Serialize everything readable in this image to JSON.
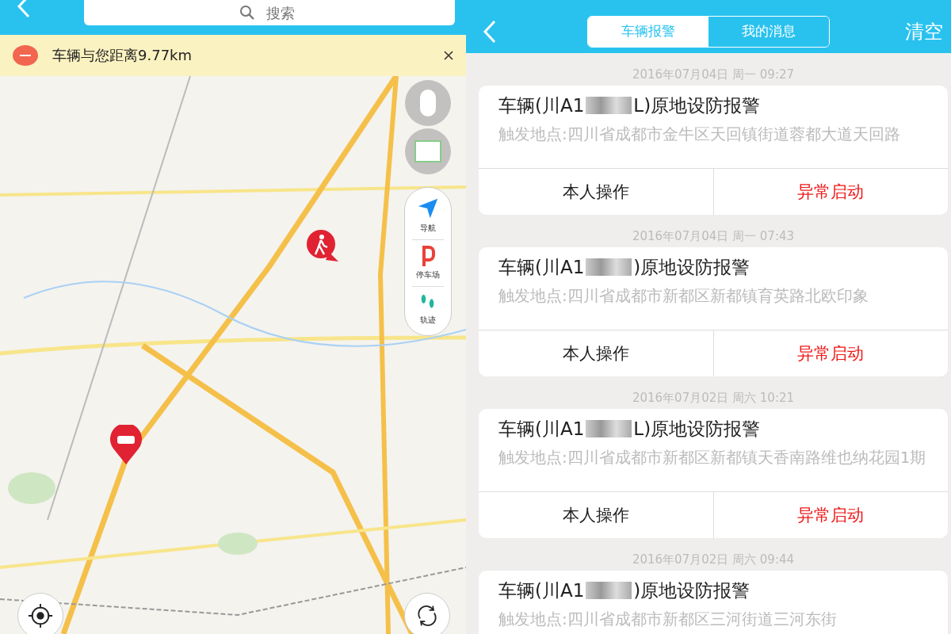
{
  "map_screen": {
    "search": {
      "placeholder": "搜索"
    },
    "banner": {
      "text": "车辆与您距离9.77km"
    },
    "side_tools": [
      {
        "kind": "navigate",
        "label": "导航"
      },
      {
        "kind": "parking",
        "label": "停车场"
      },
      {
        "kind": "track",
        "label": "轨迹"
      }
    ]
  },
  "alerts_screen": {
    "tabs": [
      {
        "label": "车辆报警",
        "selected": true
      },
      {
        "label": "我的消息",
        "selected": false
      }
    ],
    "clear_button": "清空",
    "alerts": [
      {
        "time": "2016年07月04日 周一 09:27",
        "title_start": "车辆(川A1",
        "title_end": "L)原地设防报警",
        "address": "触发地点:四川省成都市金牛区天回镇街道蓉都大道天回路",
        "actions": [
          "本人操作",
          "异常启动"
        ]
      },
      {
        "time": "2016年07月04日 周一 07:43",
        "title_start": "车辆(川A1",
        "title_end": ")原地设防报警",
        "address": "触发地点:四川省成都市新都区新都镇育英路北欧印象",
        "actions": [
          "本人操作",
          "异常启动"
        ]
      },
      {
        "time": "2016年07月02日 周六 10:21",
        "title_start": "车辆(川A1",
        "title_end": "L)原地设防报警",
        "address": "触发地点:四川省成都市新都区新都镇天香南路维也纳花园1期",
        "actions": [
          "本人操作",
          "异常启动"
        ]
      },
      {
        "time": "2016年07月02日 周六 09:44",
        "title_start": "车辆(川A1",
        "title_end": ")原地设防报警",
        "address": "触发地点:四川省成都市新都区三河街道三河东街"
      }
    ]
  }
}
